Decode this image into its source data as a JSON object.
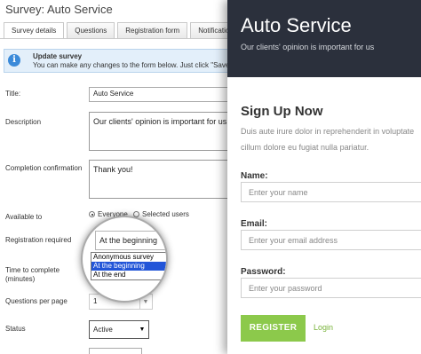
{
  "admin": {
    "title": "Survey: Auto Service",
    "tabs": [
      {
        "label": "Survey details"
      },
      {
        "label": "Questions"
      },
      {
        "label": "Registration form"
      },
      {
        "label": "Notifications"
      }
    ],
    "notice": {
      "title": "Update survey",
      "text": "You can make any changes to the form below. Just click \"Save\" to"
    },
    "fields": {
      "title_label": "Title:",
      "title_value": "Auto Service",
      "description_label": "Description",
      "description_value": "Our clients' opinion is important for us",
      "completion_label": "Completion confirmation",
      "completion_value": "Thank you!",
      "available_label": "Available to",
      "available_options": [
        "Everyone",
        "Selected users"
      ],
      "registration_label": "Registration required",
      "registration_value": "At the beginning",
      "registration_options": [
        "Anonymous survey",
        "At the beginning",
        "At the end"
      ],
      "time_label": "Time to complete (minutes)",
      "questions_label": "Questions per page",
      "questions_value": "1",
      "status_label": "Status",
      "status_value": "Active"
    }
  },
  "signup": {
    "brand": "Auto Service",
    "tagline": "Our clients' opinion is important for us",
    "form_title": "Sign Up Now",
    "lead": "Duis aute irure dolor in reprehenderit in voluptate cillum dolore eu fugiat nulla pariatur.",
    "name_label": "Name:",
    "name_placeholder": "Enter your name",
    "email_label": "Email:",
    "email_placeholder": "Enter your email address",
    "password_label": "Password:",
    "password_placeholder": "Enter your password",
    "register_label": "REGISTER",
    "login_label": "Login"
  },
  "colors": {
    "header_bg": "#2b303c",
    "accent_green": "#8cc94b",
    "selection_blue": "#2255d8",
    "notice_bg": "#e3effa"
  },
  "icons": {
    "notice": "info-icon",
    "dropdown": "chevron-down-icon"
  }
}
